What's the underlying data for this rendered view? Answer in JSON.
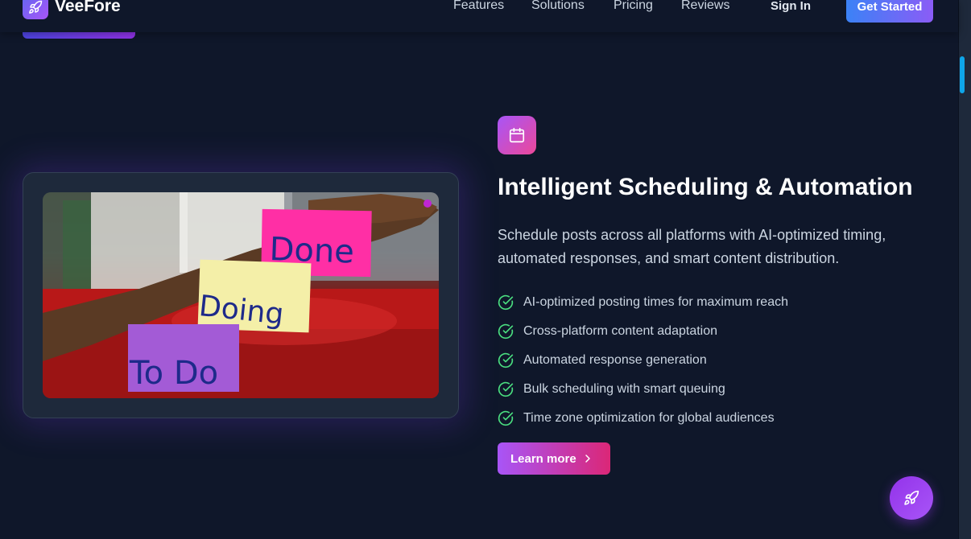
{
  "header": {
    "logo_text": "VeeFore",
    "logo_icon": "rocket-icon",
    "nav": [
      {
        "label": "Features"
      },
      {
        "label": "Solutions"
      },
      {
        "label": "Pricing"
      },
      {
        "label": "Reviews"
      }
    ],
    "signin_label": "Sign In",
    "cta_label": "Get Started"
  },
  "image_card": {
    "notes": [
      "Done",
      "Doing",
      "To Do"
    ],
    "note_colors": [
      "#ff2fa5",
      "#f4efa8",
      "#a35bd6"
    ]
  },
  "feature": {
    "icon": "calendar-icon",
    "title": "Intelligent Scheduling & Automation",
    "description": "Schedule posts across all platforms with AI-optimized timing, automated responses, and smart content distribution.",
    "bullets": [
      "AI-optimized posting times for maximum reach",
      "Cross-platform content adaptation",
      "Automated response generation",
      "Bulk scheduling with smart queuing",
      "Time zone optimization for global audiences"
    ],
    "learn_more_label": "Learn more"
  },
  "fab": {
    "icon": "rocket-icon"
  },
  "colors": {
    "background": "#0f172a",
    "accent_purple": "#a855f7",
    "accent_pink": "#db2777",
    "check_green": "#4ade80",
    "scroll_thumb": "#0ea5e9"
  }
}
